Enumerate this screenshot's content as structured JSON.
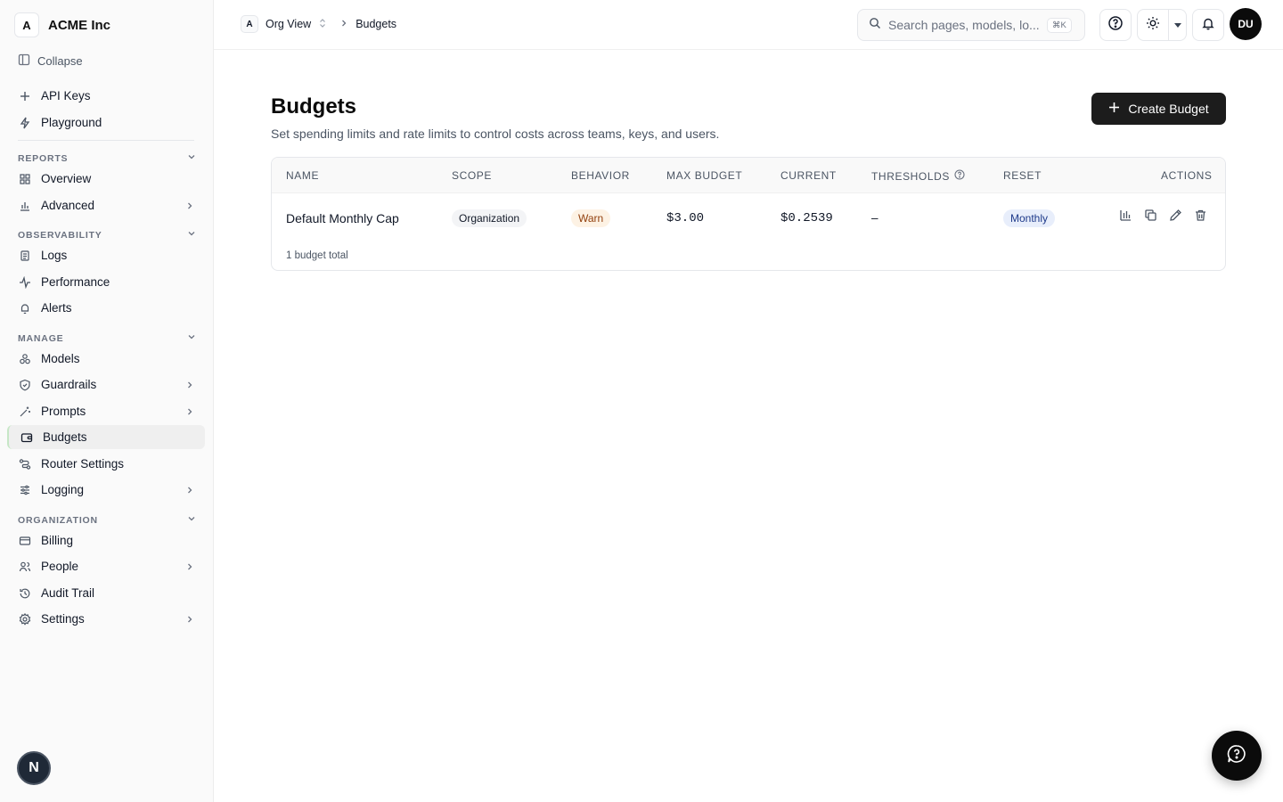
{
  "org": {
    "avatar": "A",
    "name": "ACME Inc"
  },
  "sidebar": {
    "collapse_label": "Collapse",
    "top_items": [
      {
        "label": "API Keys",
        "icon": "plus-icon"
      },
      {
        "label": "Playground",
        "icon": "bolt-icon"
      }
    ],
    "sections": [
      {
        "title": "REPORTS",
        "items": [
          {
            "label": "Overview",
            "icon": "grid-icon",
            "has_chevron": false
          },
          {
            "label": "Advanced",
            "icon": "bar-chart-icon",
            "has_chevron": true
          }
        ]
      },
      {
        "title": "OBSERVABILITY",
        "items": [
          {
            "label": "Logs",
            "icon": "scroll-icon",
            "has_chevron": false
          },
          {
            "label": "Performance",
            "icon": "activity-icon",
            "has_chevron": false
          },
          {
            "label": "Alerts",
            "icon": "bell-icon",
            "has_chevron": false
          }
        ]
      },
      {
        "title": "MANAGE",
        "items": [
          {
            "label": "Models",
            "icon": "models-icon",
            "has_chevron": false
          },
          {
            "label": "Guardrails",
            "icon": "shield-icon",
            "has_chevron": true
          },
          {
            "label": "Prompts",
            "icon": "wand-icon",
            "has_chevron": true
          },
          {
            "label": "Budgets",
            "icon": "wallet-icon",
            "has_chevron": false,
            "active": true
          },
          {
            "label": "Router Settings",
            "icon": "route-icon",
            "has_chevron": false
          },
          {
            "label": "Logging",
            "icon": "sliders-icon",
            "has_chevron": true
          }
        ]
      },
      {
        "title": "ORGANIZATION",
        "items": [
          {
            "label": "Billing",
            "icon": "credit-card-icon",
            "has_chevron": false
          },
          {
            "label": "People",
            "icon": "users-icon",
            "has_chevron": true
          },
          {
            "label": "Audit Trail",
            "icon": "history-icon",
            "has_chevron": false
          },
          {
            "label": "Settings",
            "icon": "gear-icon",
            "has_chevron": true
          }
        ]
      }
    ],
    "bottom_badge": "N"
  },
  "topbar": {
    "breadcrumb": {
      "avatar": "A",
      "org_view": "Org View",
      "current": "Budgets"
    },
    "search": {
      "placeholder": "Search pages, models, lo...",
      "shortcut": "⌘K"
    },
    "user_initials": "DU"
  },
  "main": {
    "title": "Budgets",
    "subtitle": "Set spending limits and rate limits to control costs across teams, keys, and users.",
    "create_button": "Create Budget",
    "table": {
      "columns": [
        "NAME",
        "SCOPE",
        "BEHAVIOR",
        "MAX BUDGET",
        "CURRENT",
        "THRESHOLDS",
        "RESET",
        "ACTIONS"
      ],
      "rows": [
        {
          "name": "Default Monthly Cap",
          "scope": "Organization",
          "behavior": "Warn",
          "max_budget": "$3.00",
          "current": "$0.2539",
          "thresholds": "–",
          "reset": "Monthly"
        }
      ],
      "footer": "1 budget total"
    }
  },
  "colors": {
    "primary_button": "#1c1c1c",
    "warn_bg": "#fdf2e4",
    "reset_bg": "#e8eefb"
  }
}
